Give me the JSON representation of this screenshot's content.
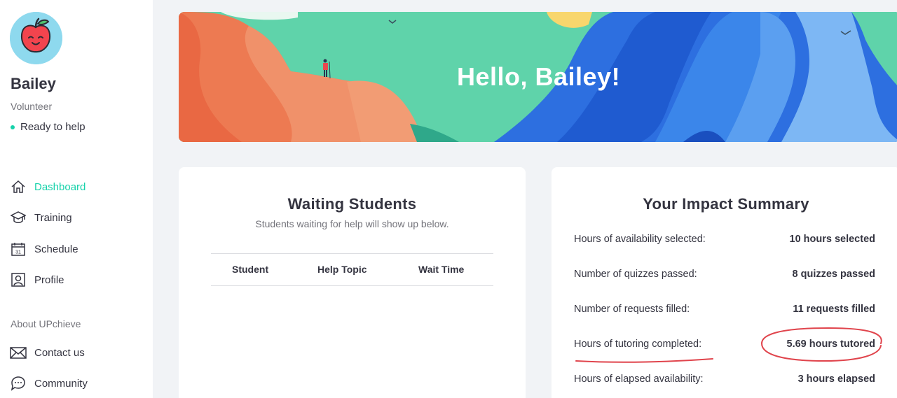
{
  "user": {
    "name": "Bailey",
    "role": "Volunteer",
    "status": "Ready to help"
  },
  "nav": {
    "items": [
      {
        "label": "Dashboard",
        "icon": "home-icon",
        "active": true
      },
      {
        "label": "Training",
        "icon": "graduation-cap-icon"
      },
      {
        "label": "Schedule",
        "icon": "calendar-icon"
      },
      {
        "label": "Profile",
        "icon": "profile-icon"
      }
    ],
    "about_heading": "About UPchieve",
    "about_items": [
      {
        "label": "Contact us",
        "icon": "mail-icon"
      },
      {
        "label": "Community",
        "icon": "chat-icon"
      }
    ]
  },
  "banner": {
    "greeting": "Hello, Bailey!"
  },
  "waiting": {
    "title": "Waiting Students",
    "subtitle": "Students waiting for help will show up below.",
    "columns": [
      "Student",
      "Help Topic",
      "Wait Time"
    ]
  },
  "impact": {
    "title": "Your Impact Summary",
    "rows": [
      {
        "label": "Hours of availability selected:",
        "value": "10 hours selected"
      },
      {
        "label": "Number of quizzes passed:",
        "value": "8 quizzes passed"
      },
      {
        "label": "Number of requests filled:",
        "value": "11 requests filled"
      },
      {
        "label": "Hours of tutoring completed:",
        "value": "5.69 hours tutored"
      },
      {
        "label": "Hours of elapsed availability:",
        "value": "3 hours elapsed"
      }
    ]
  },
  "colors": {
    "accent": "#16d2aa",
    "annotation": "#e0444c"
  }
}
